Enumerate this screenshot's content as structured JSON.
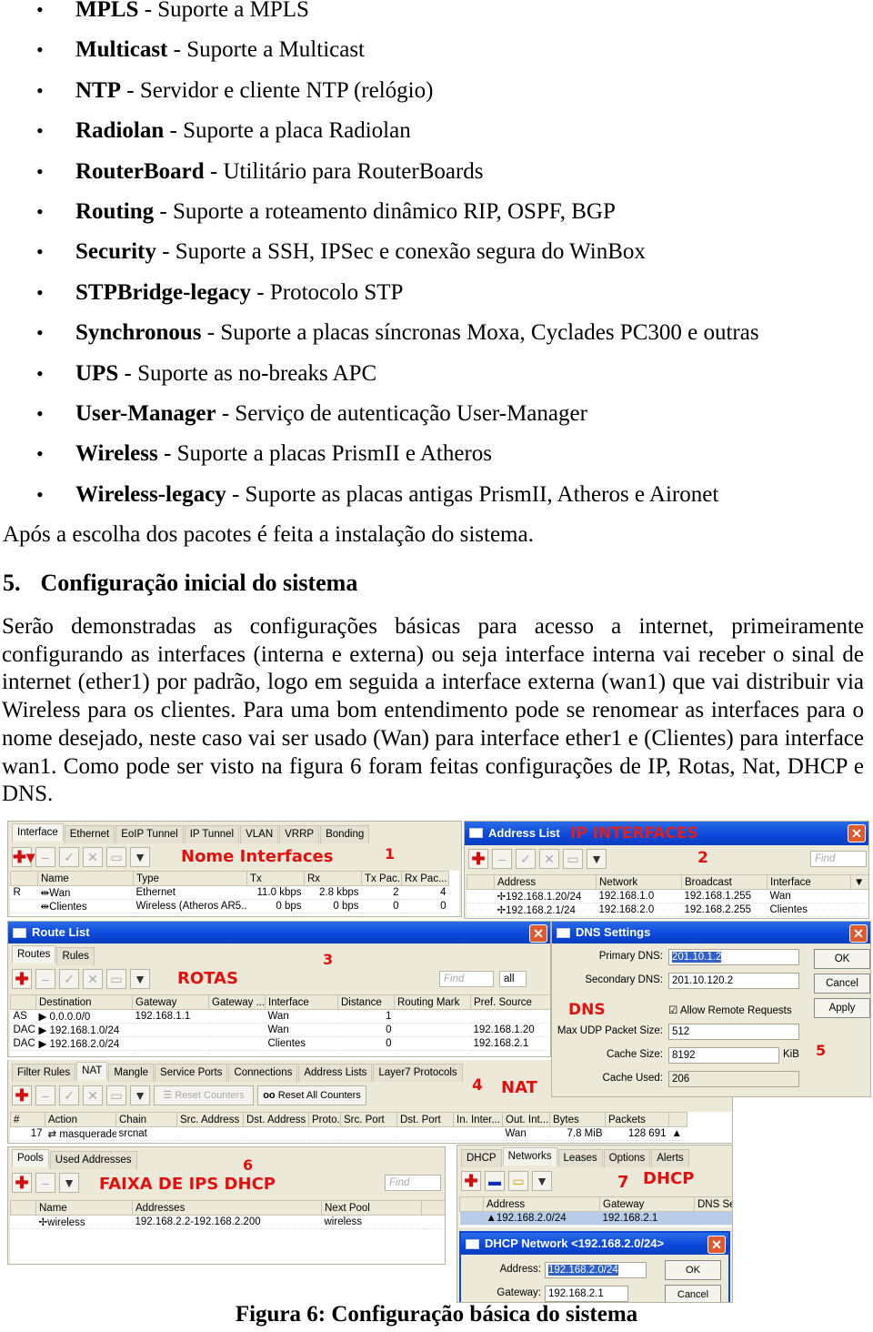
{
  "packages": [
    {
      "name": "MPLS",
      "desc": "Suporte a MPLS"
    },
    {
      "name": "Multicast",
      "desc": " Suporte a Multicast"
    },
    {
      "name": "NTP",
      "desc": "Servidor e cliente NTP (relógio)"
    },
    {
      "name": "Radiolan",
      "desc": "Suporte a placa Radiolan"
    },
    {
      "name": "RouterBoard",
      "desc": "Utilitário para RouterBoards"
    },
    {
      "name": "Routing",
      "desc": "Suporte a roteamento dinâmico RIP, OSPF, BGP"
    },
    {
      "name": "Security",
      "desc": "Suporte a SSH, IPSec e conexão segura do WinBox"
    },
    {
      "name": "STPBridge-legacy",
      "desc": "Protocolo STP"
    },
    {
      "name": "Synchronous",
      "desc": "Suporte a placas síncronas Moxa, Cyclades PC300 e outras"
    },
    {
      "name": "UPS",
      "desc": "Suporte as no-breaks APC"
    },
    {
      "name": "User-Manager",
      "desc": "Serviço de autenticação User-Manager"
    },
    {
      "name": "Wireless",
      "desc": "Suporte a placas PrismII e Atheros"
    },
    {
      "name": "Wireless-legacy",
      "desc": "Suporte as placas antigas PrismII, Atheros e Aironet"
    }
  ],
  "after_list": "Após a escolha dos pacotes é feita a instalação do sistema.",
  "section": {
    "number": "5.",
    "title": "Configuração inicial do sistema"
  },
  "paragraph": "Serão demonstradas as configurações básicas para acesso a internet, primeiramente configurando as interfaces (interna e externa) ou seja interface interna vai receber o sinal de internet (ether1) por padrão, logo em seguida a interface externa (wan1) que vai distribuir via Wireless para os clientes. Para uma bom entendimento pode se renomear as interfaces para o nome desejado, neste caso vai ser usado (Wan) para interface ether1 e (Clientes) para interface wan1. Como pode ser visto na figura 6 foram feitas configurações de IP, Rotas, Nat, DHCP e DNS.",
  "figure": {
    "caption": "Figura 6: Configuração básica do sistema",
    "interfaces": {
      "tabs": [
        "Interface",
        "Ethernet",
        "EoIP Tunnel",
        "IP Tunnel",
        "VLAN",
        "VRRP",
        "Bonding"
      ],
      "annotation": "Nome Interfaces",
      "number": "1",
      "table": {
        "columns": [
          "",
          "Name",
          "Type",
          "Tx",
          "Rx",
          "Tx Pac...",
          "Rx Pac..."
        ],
        "rows": [
          [
            "R",
            "⇹Wan",
            "Ethernet",
            "11.0 kbps",
            "2.8 kbps",
            "2",
            "4"
          ],
          [
            "",
            "⇹Clientes",
            "Wireless (Atheros AR5...",
            "0 bps",
            "0 bps",
            "0",
            "0"
          ]
        ]
      }
    },
    "address_list": {
      "title": "Address List",
      "annotation": "IP INTERFACES",
      "number": "2",
      "find": "Find",
      "table": {
        "columns": [
          "",
          "Address",
          "Network",
          "Broadcast",
          "Interface",
          "▼"
        ],
        "rows": [
          [
            "",
            "✢192.168.1.20/24",
            "192.168.1.0",
            "192.168.1.255",
            "Wan",
            ""
          ],
          [
            "",
            "✢192.168.2.1/24",
            "192.168.2.0",
            "192.168.2.255",
            "Clientes",
            ""
          ]
        ]
      }
    },
    "route_list": {
      "title": "Route List",
      "tabs": [
        "Routes",
        "Rules"
      ],
      "annotation": "ROTAS",
      "number": "3",
      "find": "Find",
      "filter": "all",
      "table": {
        "columns": [
          "",
          "Destination",
          "Gateway",
          "Gateway ...",
          "Interface",
          "Distance",
          "Routing Mark",
          "Pref. Source"
        ],
        "rows": [
          [
            "AS",
            "▶ 0.0.0.0/0",
            "192.168.1.1",
            "",
            "Wan",
            "1",
            "",
            ""
          ],
          [
            "DAC",
            "▶ 192.168.1.0/24",
            "",
            "",
            "Wan",
            "0",
            "",
            "192.168.1.20"
          ],
          [
            "DAC",
            "▶ 192.168.2.0/24",
            "",
            "",
            "Clientes",
            "0",
            "",
            "192.168.2.1"
          ]
        ]
      }
    },
    "dns": {
      "title": "DNS Settings",
      "annotation": "DNS",
      "number": "5",
      "primary_label": "Primary DNS:",
      "primary": "201.10.1.2",
      "secondary_label": "Secondary DNS:",
      "secondary": "201.10.120.2",
      "allow_remote": "Allow Remote Requests",
      "allow_remote_checked": true,
      "udp_label": "Max UDP Packet Size:",
      "udp": "512",
      "cache_size_label": "Cache Size:",
      "cache_size": "8192",
      "cache_unit": "KiB",
      "cache_used_label": "Cache Used:",
      "cache_used": "206",
      "ok": "OK",
      "cancel": "Cancel",
      "apply": "Apply"
    },
    "nat": {
      "tabs": [
        "Filter Rules",
        "NAT",
        "Mangle",
        "Service Ports",
        "Connections",
        "Address Lists",
        "Layer7 Protocols"
      ],
      "annotation_number": "4",
      "annotation": "NAT",
      "reset_counters": "Reset Counters",
      "reset_all": "Reset All Counters",
      "table": {
        "columns": [
          "#",
          "Action",
          "Chain",
          "Src. Address",
          "Dst. Address",
          "Proto...",
          "Src. Port",
          "Dst. Port",
          "In. Inter...",
          "Out. Int...",
          "Bytes",
          "Packets",
          ""
        ],
        "rows": [
          [
            "17",
            "⇄ masquerade",
            "srcnat",
            "",
            "",
            "",
            "",
            "",
            "",
            "Wan",
            "7.8 MiB",
            "128 691",
            "▲"
          ]
        ]
      }
    },
    "pools": {
      "tabs": [
        "Pools",
        "Used Addresses"
      ],
      "annotation": "FAIXA DE IPS DHCP",
      "number": "6",
      "find": "Find",
      "table": {
        "columns": [
          "",
          "Name",
          "Addresses",
          "Next Pool",
          ""
        ],
        "rows": [
          [
            "",
            "✢wireless",
            "192.168.2.2-192.168.2.200",
            "wireless",
            ""
          ]
        ]
      }
    },
    "dhcp": {
      "tabs": [
        "DHCP",
        "Networks",
        "Leases",
        "Options",
        "Alerts"
      ],
      "number": "7",
      "annotation": "DHCP",
      "table": {
        "columns": [
          "",
          "Address",
          "Gateway",
          "DNS Se"
        ],
        "rows": [
          [
            "",
            "▲192.168.2.0/24",
            "192.168.2.1",
            ""
          ]
        ]
      },
      "dialog": {
        "title": "DHCP Network <192.168.2.0/24>",
        "address_label": "Address:",
        "address": "192.168.2.0/24",
        "gateway_label": "Gateway:",
        "gateway": "192.168.2.1",
        "ok": "OK",
        "cancel": "Cancel"
      }
    }
  }
}
